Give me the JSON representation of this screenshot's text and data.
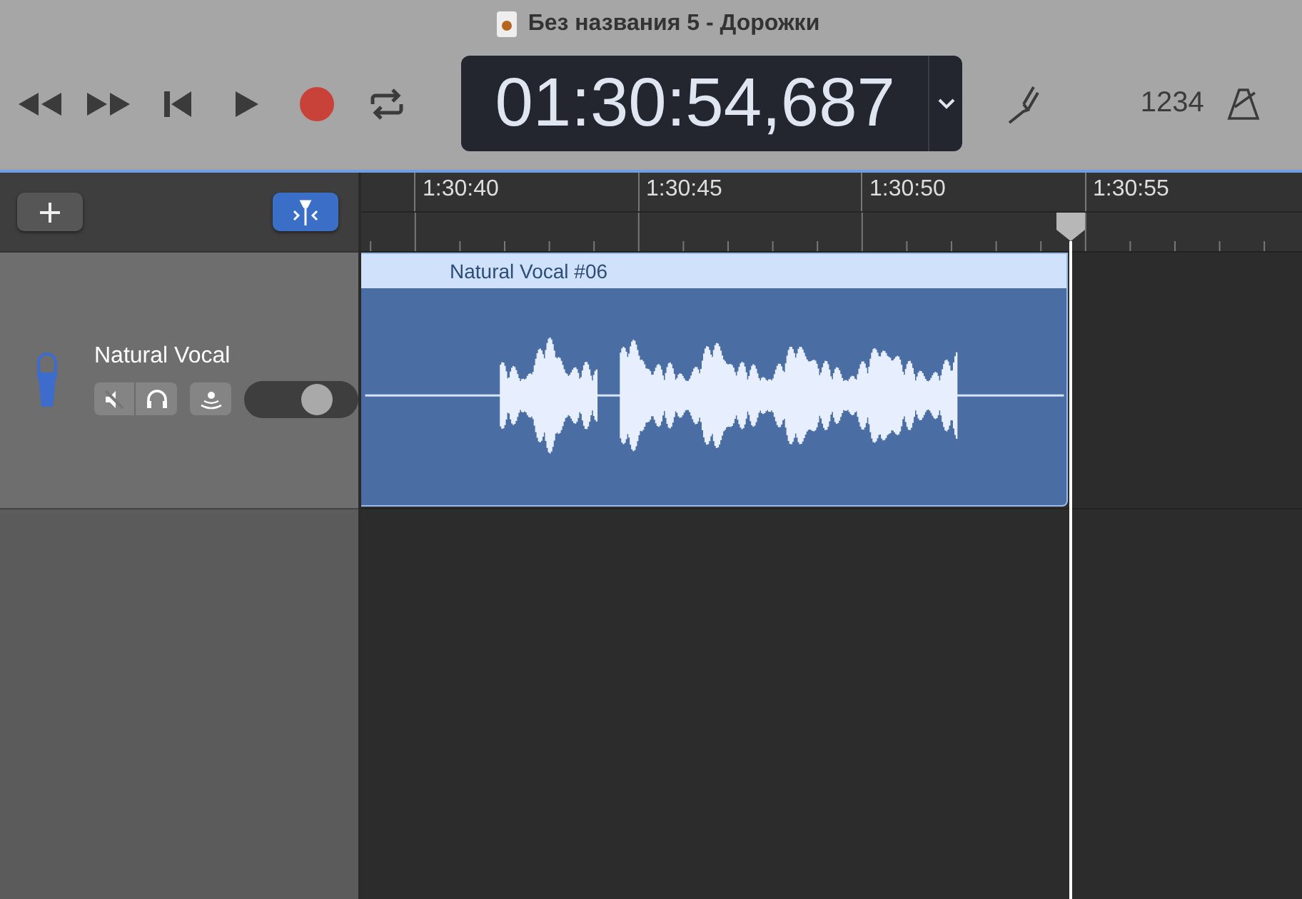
{
  "window": {
    "title": "Без названия 5 - Дорожки"
  },
  "transport": [
    {
      "kind": "rewind"
    },
    {
      "kind": "forward"
    },
    {
      "kind": "start"
    },
    {
      "kind": "play"
    },
    {
      "kind": "record"
    },
    {
      "kind": "cycle"
    }
  ],
  "lcd": {
    "time": "01:30:54,687"
  },
  "count_in": "1234",
  "track_toolbar": {
    "smart_controls_selected": true
  },
  "ruler": {
    "labels": [
      "1:30:40",
      "1:30:45",
      "1:30:50",
      "1:30:55"
    ]
  },
  "tracks": [
    {
      "name": "Natural Vocal",
      "muted": false,
      "solo": false,
      "volume": {
        "level": 0.72
      },
      "region": {
        "name": "Natural Vocal #06"
      }
    }
  ]
}
